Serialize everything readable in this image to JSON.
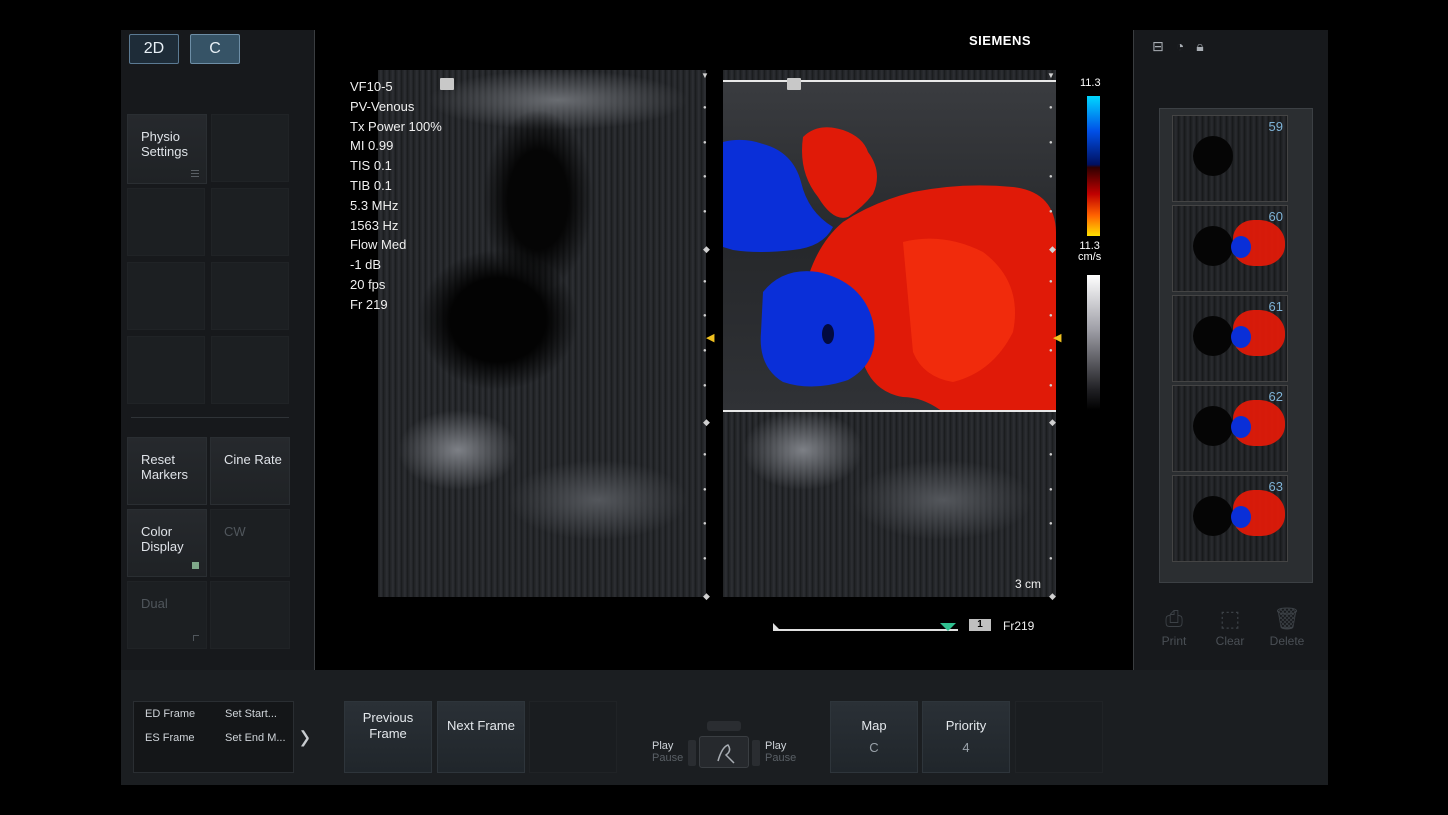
{
  "modes": {
    "mode_2d": "2D",
    "mode_c": "C"
  },
  "left_buttons": {
    "physio": "Physio Settings",
    "reset_markers": "Reset Markers",
    "cine_rate": "Cine Rate",
    "color_display": "Color Display",
    "cw": "CW",
    "dual": "Dual"
  },
  "brand": "SIEMENS",
  "params": [
    "VF10-5",
    "PV-Venous",
    "Tx Power 100%",
    "MI 0.99",
    "TIS 0.1",
    "TIB 0.1",
    "5.3 MHz",
    "1563 Hz",
    "Flow Med",
    "-1 dB",
    "20 fps",
    "Fr 219"
  ],
  "scale": {
    "top": "11.3",
    "mid_value": "11.3",
    "mid_unit": "cm/s"
  },
  "depth_label": "3 cm",
  "cine": {
    "badge": "1",
    "frame": "Fr219"
  },
  "thumbnails": [
    "59",
    "60",
    "61",
    "62",
    "63"
  ],
  "right_actions": {
    "print": "Print",
    "clear": "Clear",
    "delete": "Delete"
  },
  "bottom": {
    "ed_frame": "ED Frame",
    "es_frame": "ES Frame",
    "set_start": "Set Start...",
    "set_end": "Set End M...",
    "previous_frame": "Previous Frame",
    "next_frame": "Next Frame",
    "play_left": "Play",
    "pause_left": "Pause",
    "play_right": "Play",
    "pause_right": "Pause",
    "map_label": "Map",
    "map_value": "C",
    "priority_label": "Priority",
    "priority_value": "4"
  },
  "colors": {
    "flow_red": "#e01a08",
    "flow_blue": "#0a2fd8",
    "accent": "#365366"
  }
}
